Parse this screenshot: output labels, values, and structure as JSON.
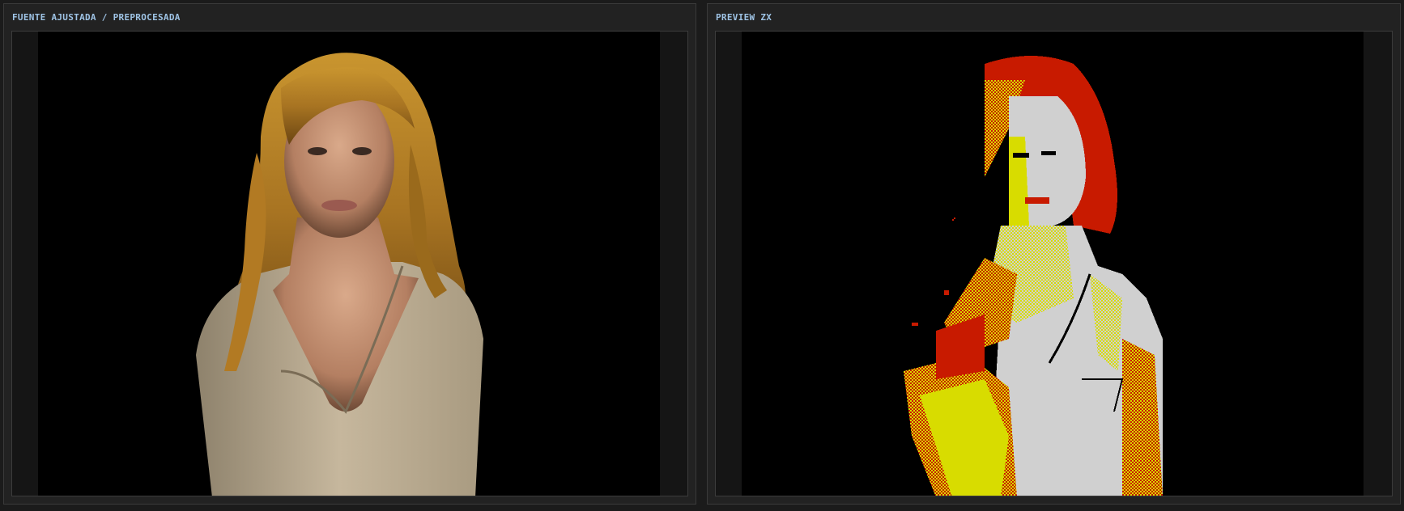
{
  "panels": {
    "source": {
      "title": "FUENTE AJUSTADA / PREPROCESADA",
      "image": "photo-portrait-woman"
    },
    "preview": {
      "title": "PREVIEW ZX",
      "image": "zx-dithered-portrait"
    }
  },
  "colors": {
    "background": "#1b1b1b",
    "panel": "#222222",
    "title": "#9fc4e6",
    "canvas": "#000000",
    "zx_red": "#c81a00",
    "zx_yellow": "#d8dc00",
    "zx_white": "#d0d0d0"
  }
}
